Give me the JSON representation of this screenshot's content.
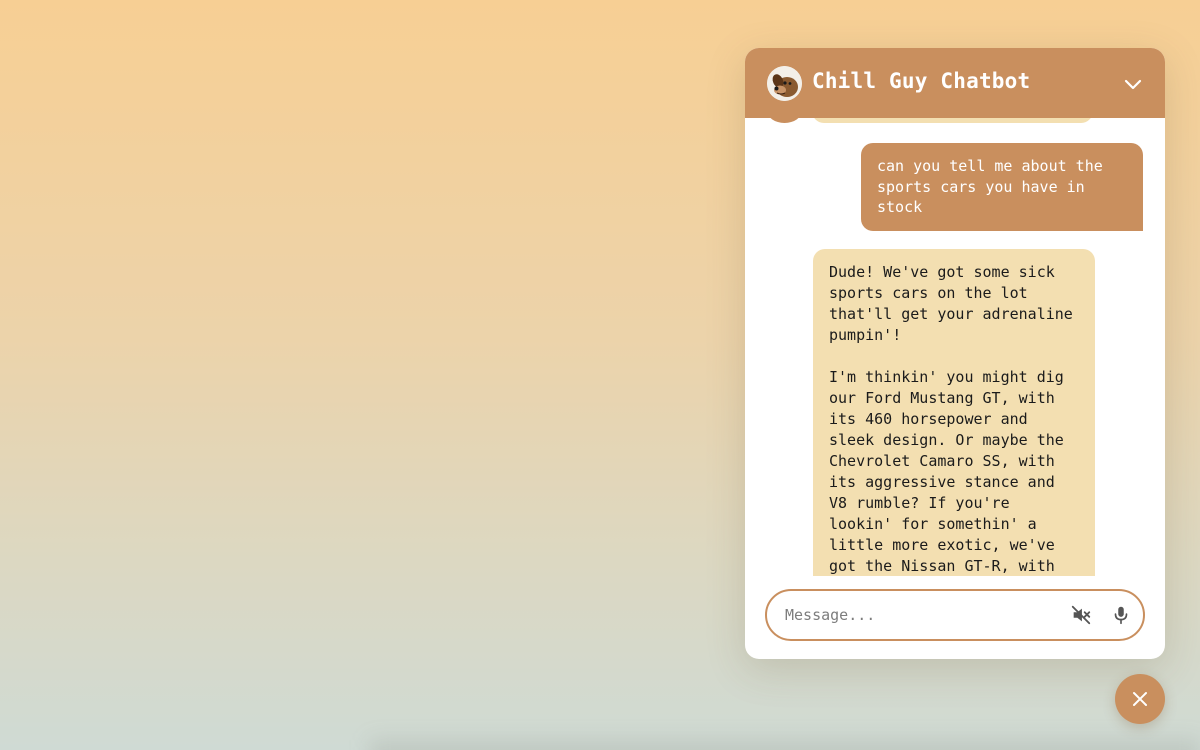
{
  "colors": {
    "accent": "#c98f5e",
    "bot_bubble": "#f3dfb1",
    "user_text": "#ffffff",
    "bot_text": "#1b1b1b"
  },
  "header": {
    "title": "Chill Guy Chatbot",
    "avatar_icon": "dog-avatar-icon",
    "collapse_icon": "chevron-down-icon"
  },
  "messages": {
    "user": "can you tell me about the sports cars you have in stock",
    "bot": "Dude! We've got some sick sports cars on the lot that'll get your adrenaline pumpin'!\n\nI'm thinkin' you might dig our Ford Mustang GT, with its 460 horsepower and sleek design. Or maybe the Chevrolet Camaro SS, with its aggressive stance and V8 rumble? If you're lookin' for somethin' a little more exotic, we've got the Nissan GT-R, with"
  },
  "composer": {
    "placeholder": "Message...",
    "value": "",
    "mute_icon": "speaker-muted-icon",
    "mic_icon": "microphone-icon"
  },
  "launcher": {
    "close_icon": "close-icon"
  }
}
